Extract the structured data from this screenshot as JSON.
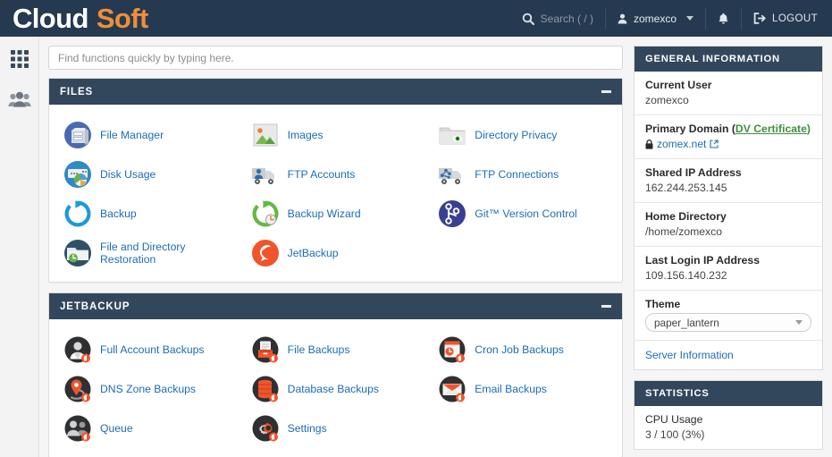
{
  "brand": {
    "part1": "Cloud",
    "part2": "Soft"
  },
  "header": {
    "search_placeholder": "Search ( / )",
    "user": "zomexco",
    "logout": "LOGOUT"
  },
  "find": {
    "placeholder": "Find functions quickly by typing here."
  },
  "panels": [
    {
      "title": "FILES",
      "items": [
        {
          "label": "File Manager",
          "icon": "file-manager-icon"
        },
        {
          "label": "Images",
          "icon": "images-icon"
        },
        {
          "label": "Directory Privacy",
          "icon": "directory-privacy-icon"
        },
        {
          "label": "Disk Usage",
          "icon": "disk-usage-icon"
        },
        {
          "label": "FTP Accounts",
          "icon": "ftp-accounts-icon"
        },
        {
          "label": "FTP Connections",
          "icon": "ftp-connections-icon"
        },
        {
          "label": "Backup",
          "icon": "backup-icon"
        },
        {
          "label": "Backup Wizard",
          "icon": "backup-wizard-icon"
        },
        {
          "label": "Git™ Version Control",
          "icon": "git-version-control-icon"
        },
        {
          "label": "File and Directory Restoration",
          "icon": "file-restoration-icon"
        },
        {
          "label": "JetBackup",
          "icon": "jetbackup-icon"
        }
      ]
    },
    {
      "title": "JETBACKUP",
      "items": [
        {
          "label": "Full Account Backups",
          "icon": "full-account-backups-icon"
        },
        {
          "label": "File Backups",
          "icon": "file-backups-icon"
        },
        {
          "label": "Cron Job Backups",
          "icon": "cron-job-backups-icon"
        },
        {
          "label": "DNS Zone Backups",
          "icon": "dns-zone-backups-icon"
        },
        {
          "label": "Database Backups",
          "icon": "database-backups-icon"
        },
        {
          "label": "Email Backups",
          "icon": "email-backups-icon"
        },
        {
          "label": "Queue",
          "icon": "queue-icon"
        },
        {
          "label": "Settings",
          "icon": "settings-icon"
        }
      ]
    }
  ],
  "general_information": {
    "title": "GENERAL INFORMATION",
    "current_user_label": "Current User",
    "current_user_value": "zomexco",
    "primary_domain_label": "Primary Domain (",
    "primary_domain_cert": "DV Certificate",
    "primary_domain_label_end": ")",
    "primary_domain_value": "zomex.net",
    "shared_ip_label": "Shared IP Address",
    "shared_ip_value": "162.244.253.145",
    "home_dir_label": "Home Directory",
    "home_dir_value": "/home/zomexco",
    "last_login_label": "Last Login IP Address",
    "last_login_value": "109.156.140.232",
    "theme_label": "Theme",
    "theme_value": "paper_lantern",
    "server_information": "Server Information"
  },
  "statistics": {
    "title": "STATISTICS",
    "cpu_label": "CPU Usage",
    "cpu_value": "3 / 100  (3%)"
  },
  "colors": {
    "header_bg": "#253a50",
    "panel_head": "#32475c",
    "accent_orange": "#ef8e3a",
    "link_blue": "#1c6cb5",
    "cert_green": "#3f8f3f"
  }
}
